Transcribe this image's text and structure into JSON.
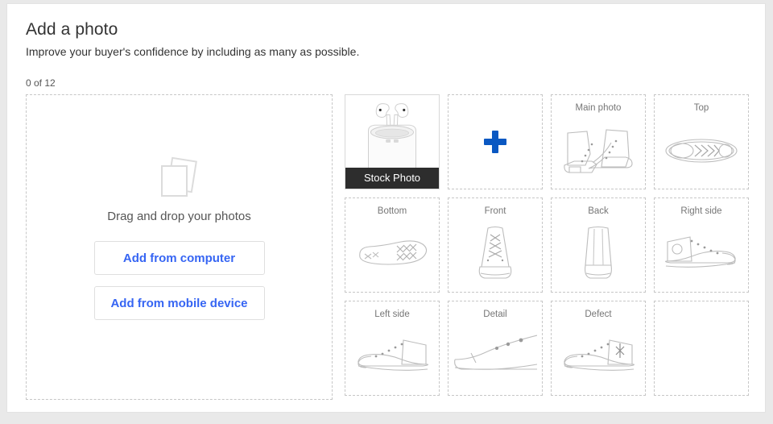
{
  "page": {
    "title": "Add a photo",
    "subtitle": "Improve your buyer's confidence by including as many as possible.",
    "counter": "0 of 12"
  },
  "dropzone": {
    "icon": "photos-stack-icon",
    "text": "Drag and drop your photos",
    "buttons": [
      {
        "label": "Add from computer",
        "name": "add-from-computer-button"
      },
      {
        "label": "Add from mobile device",
        "name": "add-from-mobile-device-button"
      }
    ]
  },
  "colors": {
    "accent_blue": "#3665f3",
    "plus_blue": "#0a58c2",
    "stock_bar": "#2d2d2d",
    "label_gray": "#767676",
    "art_gray": "#b9b9b9",
    "dashed_border": "#c7c7c7",
    "page_bg": "#e9e9e9"
  },
  "tiles": [
    {
      "kind": "stock",
      "label": "Stock Photo",
      "art": "airpods-photo"
    },
    {
      "kind": "add",
      "label": "",
      "art": "plus-icon"
    },
    {
      "kind": "slot",
      "label": "Main photo",
      "art": "sneaker-pair-icon"
    },
    {
      "kind": "slot",
      "label": "Top",
      "art": "shoe-top-view-icon"
    },
    {
      "kind": "slot",
      "label": "Bottom",
      "art": "shoe-sole-icon"
    },
    {
      "kind": "slot",
      "label": "Front",
      "art": "shoe-front-view-icon"
    },
    {
      "kind": "slot",
      "label": "Back",
      "art": "shoe-back-view-icon"
    },
    {
      "kind": "slot",
      "label": "Right side",
      "art": "shoe-right-side-icon"
    },
    {
      "kind": "slot",
      "label": "Left side",
      "art": "shoe-left-side-icon"
    },
    {
      "kind": "slot",
      "label": "Detail",
      "art": "shoe-detail-icon"
    },
    {
      "kind": "slot",
      "label": "Defect",
      "art": "shoe-defect-icon"
    },
    {
      "kind": "empty",
      "label": "",
      "art": ""
    }
  ]
}
